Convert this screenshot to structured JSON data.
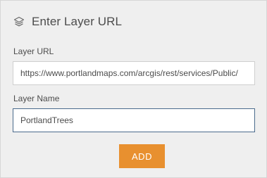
{
  "header": {
    "icon": "layers-icon",
    "title": "Enter Layer URL"
  },
  "fields": {
    "url": {
      "label": "Layer URL",
      "value": "https://www.portlandmaps.com/arcgis/rest/services/Public/"
    },
    "name": {
      "label": "Layer Name",
      "value": "PortlandTrees"
    }
  },
  "actions": {
    "add_label": "ADD"
  },
  "colors": {
    "panel_bg": "#efefef",
    "accent": "#e8902f",
    "focus_border": "#4a6a8c",
    "text": "#4c4c4c"
  }
}
